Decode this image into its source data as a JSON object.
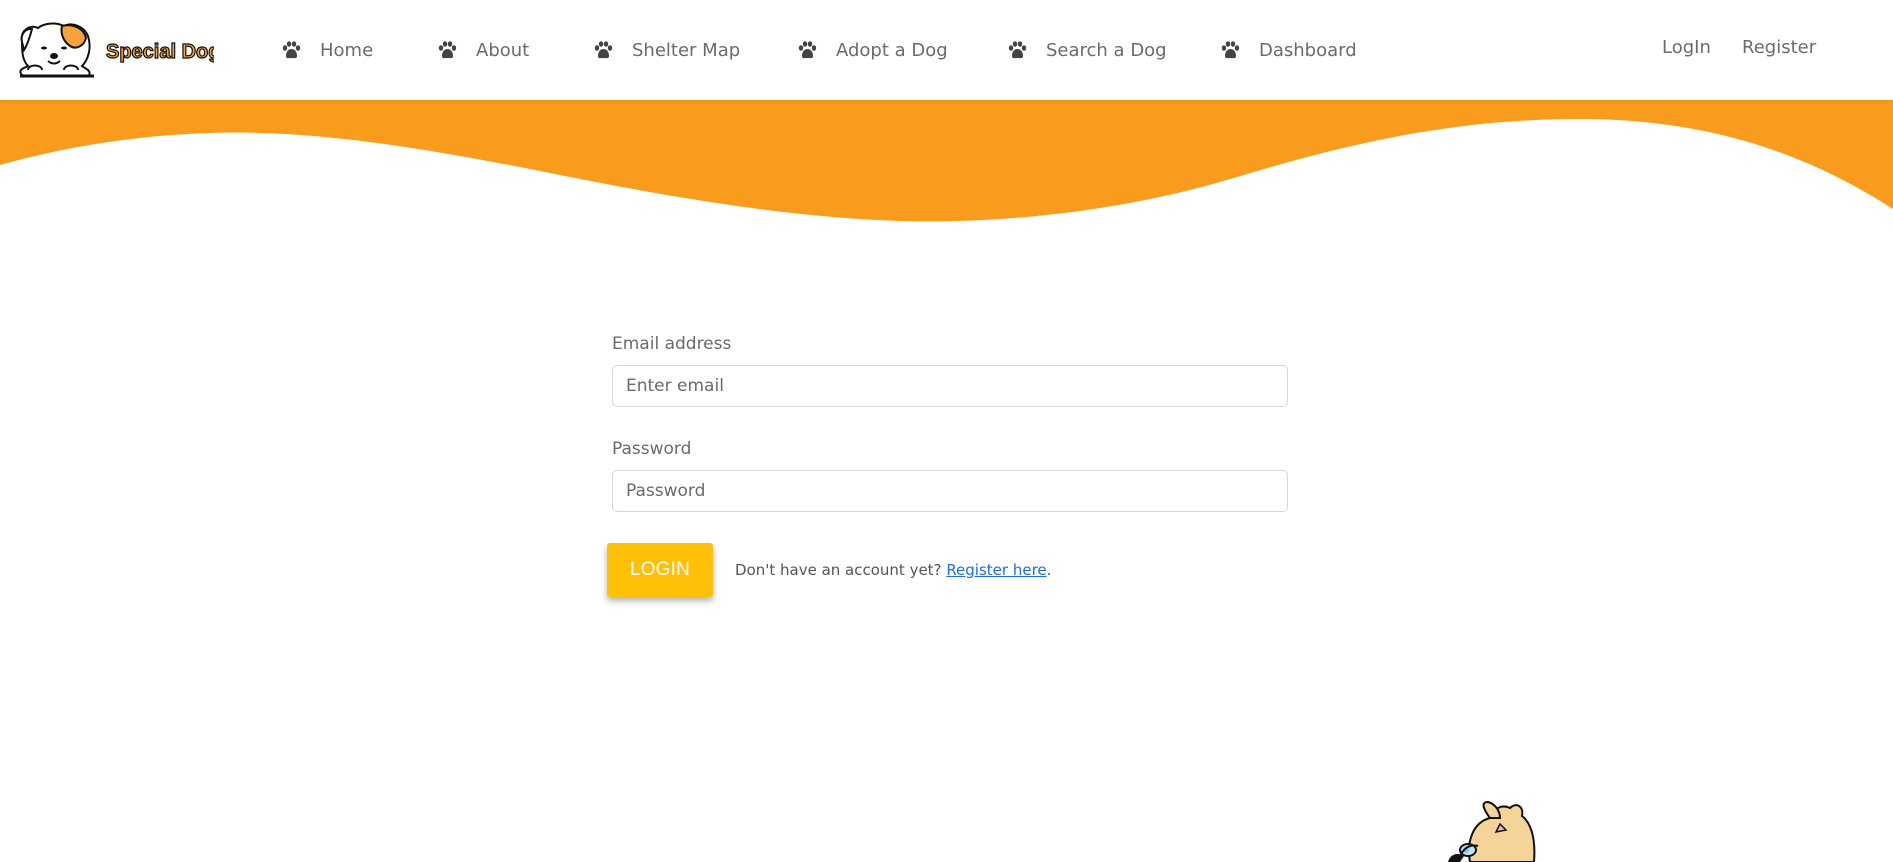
{
  "brand": {
    "name": "Special Dog",
    "logo_icon": "cartoon-dog-logo-icon",
    "accent": "#f7931e"
  },
  "nav": {
    "items": [
      {
        "label": "Home",
        "icon": "paw-icon"
      },
      {
        "label": "About",
        "icon": "paw-icon"
      },
      {
        "label": "Shelter Map",
        "icon": "paw-icon"
      },
      {
        "label": "Adopt a Dog",
        "icon": "paw-icon"
      },
      {
        "label": "Search a Dog",
        "icon": "paw-icon"
      },
      {
        "label": "Dashboard",
        "icon": "paw-icon"
      }
    ],
    "login_label": "LogIn",
    "register_label": "Register"
  },
  "banner": {
    "color": "#f99b1c"
  },
  "form": {
    "email_label": "Email address",
    "email_placeholder": "Enter email",
    "password_label": "Password",
    "password_placeholder": "Password",
    "submit_label": "LOGIN",
    "button_color": "#ffc107",
    "signup_prompt": "Don't have an account yet?",
    "signup_link": "Register here",
    "signup_suffix": "."
  },
  "decoration": {
    "corner_icon": "peeking-dog-icon"
  }
}
